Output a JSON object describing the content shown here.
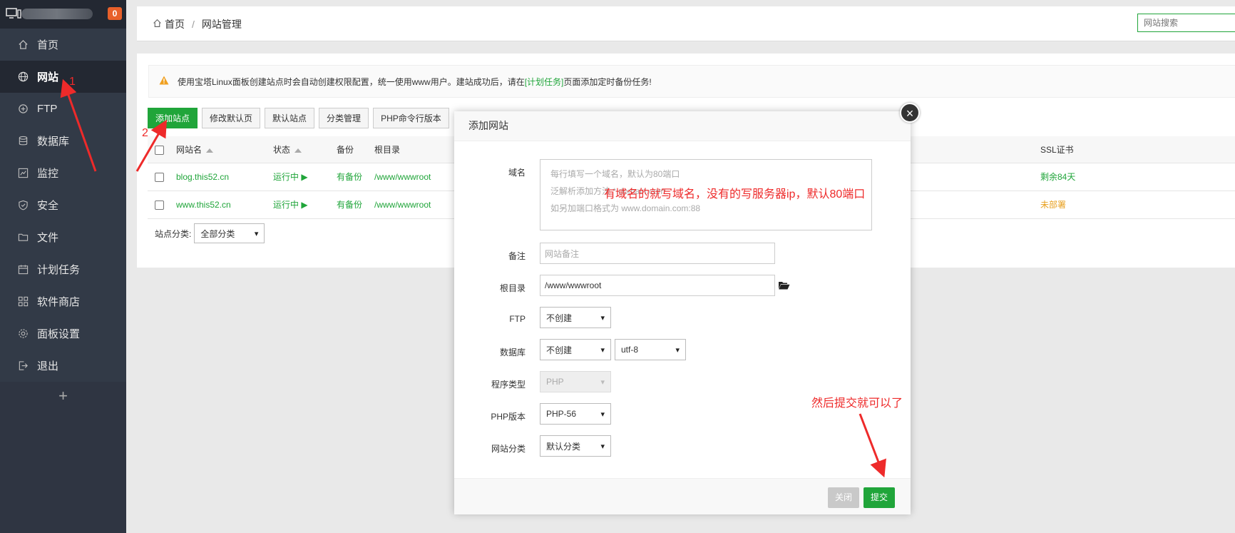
{
  "sidebar": {
    "badge": "0",
    "items": [
      {
        "label": "首页",
        "icon": "home-icon"
      },
      {
        "label": "网站",
        "icon": "globe-icon"
      },
      {
        "label": "FTP",
        "icon": "ftp-icon"
      },
      {
        "label": "数据库",
        "icon": "database-icon"
      },
      {
        "label": "监控",
        "icon": "monitor-chart-icon"
      },
      {
        "label": "安全",
        "icon": "shield-icon"
      },
      {
        "label": "文件",
        "icon": "folder-icon"
      },
      {
        "label": "计划任务",
        "icon": "calendar-icon"
      },
      {
        "label": "软件商店",
        "icon": "grid-icon"
      },
      {
        "label": "面板设置",
        "icon": "gear-icon"
      },
      {
        "label": "退出",
        "icon": "logout-icon"
      }
    ],
    "add": "+"
  },
  "header": {
    "breadcrumb_home": "首页",
    "breadcrumb_current": "网站管理",
    "search_placeholder": "网站搜索"
  },
  "notice": {
    "text_before": "使用宝塔Linux面板创建站点时会自动创建权限配置，统一使用www用户。建站成功后，请在",
    "link": "[计划任务]",
    "text_after": "页面添加定时备份任务!"
  },
  "toolbar": {
    "add_site": "添加站点",
    "modify_default_page": "修改默认页",
    "default_site": "默认站点",
    "category_manage": "分类管理",
    "php_cli": "PHP命令行版本"
  },
  "table": {
    "headers": {
      "name": "网站名",
      "status": "状态",
      "backup": "备份",
      "root": "根目录",
      "ssl": "SSL证书"
    },
    "rows": [
      {
        "name": "blog.this52.cn",
        "status": "运行中 ▶",
        "backup": "有备份",
        "root": "/www/wwwroot",
        "ssl": "剩余84天"
      },
      {
        "name": "www.this52.cn",
        "status": "运行中 ▶",
        "backup": "有备份",
        "root": "/www/wwwroot",
        "ssl": "未部署"
      }
    ]
  },
  "filter": {
    "label": "站点分类:",
    "value": "全部分类"
  },
  "modal": {
    "title": "添加网站",
    "close": "×",
    "domain_label": "域名",
    "domain_placeholder_lines": [
      "每行填写一个域名，默认为80端口",
      "泛解析添加方法 *.domain.com",
      "如另加端口格式为 www.domain.com:88"
    ],
    "remark_label": "备注",
    "remark_placeholder": "网站备注",
    "root_label": "根目录",
    "root_value": "/www/wwwroot",
    "ftp_label": "FTP",
    "ftp_value": "不创建",
    "db_label": "数据库",
    "db_value": "不创建",
    "db_charset": "utf-8",
    "program_label": "程序类型",
    "program_value": "PHP",
    "php_label": "PHP版本",
    "php_value": "PHP-56",
    "category_label": "网站分类",
    "category_value": "默认分类",
    "btn_close": "关闭",
    "btn_submit": "提交"
  },
  "annotations": {
    "num1": "1",
    "num2": "2",
    "domain_note": "有域名的就写域名，没有的写服务器ip，默认80端口",
    "submit_note": "然后提交就可以了"
  },
  "colors": {
    "accent": "#20a53a",
    "sidebar": "#2f3542",
    "annotation": "#ee2a2a",
    "badge": "#e8602a"
  }
}
